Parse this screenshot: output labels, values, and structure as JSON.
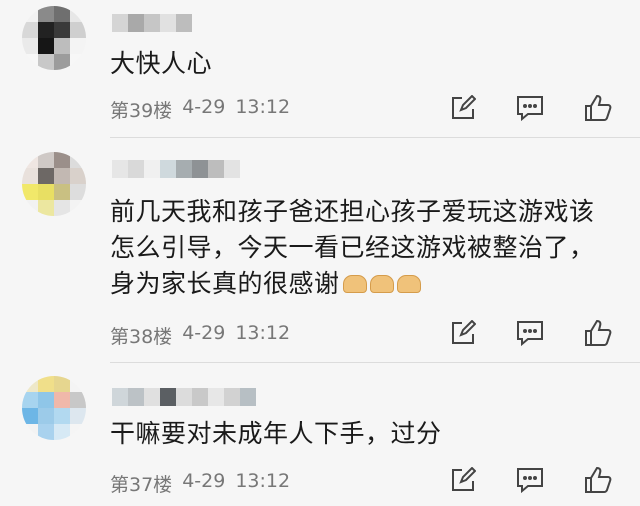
{
  "comments": [
    {
      "text_lines": [
        "大快人心"
      ],
      "floor": "第39楼",
      "date": "4-29",
      "time": "13:12",
      "emojis": 0
    },
    {
      "text_lines": [
        "前几天我和孩子爸还担心孩子爱玩这游戏该",
        "怎么引导，今天一看已经这游戏被整治了，",
        "身为家长真的很感谢"
      ],
      "floor": "第38楼",
      "date": "4-29",
      "time": "13:12",
      "emojis": 3
    },
    {
      "text_lines": [
        "干嘛要对未成年人下手，过分"
      ],
      "floor": "第37楼",
      "date": "4-29",
      "time": "13:12",
      "emojis": 0
    }
  ],
  "icons": {
    "edit": "edit-icon",
    "comment": "comment-icon",
    "like": "thumbs-up-icon",
    "emoji": "praying-hands-emoji"
  }
}
